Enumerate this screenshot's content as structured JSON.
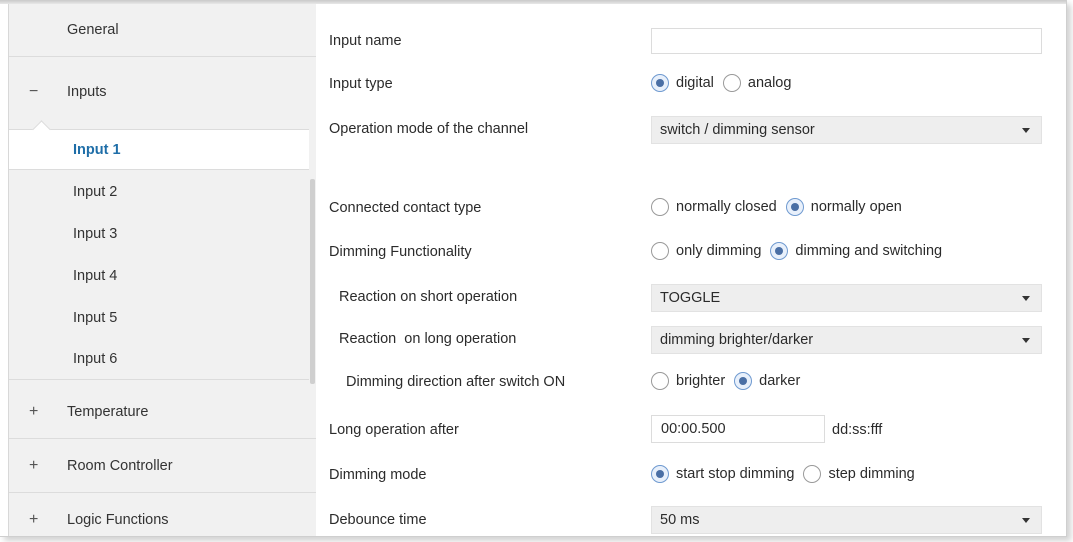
{
  "sidebar": {
    "general": "General",
    "inputs": {
      "symbol": "−",
      "label": "Inputs"
    },
    "sub_items": [
      "Input 1",
      "Input 2",
      "Input 3",
      "Input 4",
      "Input 5",
      "Input 6"
    ],
    "temperature": {
      "symbol": "+",
      "label": "Temperature"
    },
    "room_controller": {
      "symbol": "+",
      "label": "Room Controller"
    },
    "logic_functions": {
      "symbol": "+",
      "label": "Logic Functions"
    }
  },
  "form": {
    "input_name": {
      "label": "Input name",
      "value": ""
    },
    "input_type": {
      "label": "Input type",
      "options": [
        "digital",
        "analog"
      ],
      "selected": "digital"
    },
    "operation_mode": {
      "label": "Operation mode of the channel",
      "value": "switch / dimming sensor"
    },
    "contact_type": {
      "label": "Connected contact type",
      "options": [
        "normally closed",
        "normally open"
      ],
      "selected": "normally open"
    },
    "dimming_functionality": {
      "label": "Dimming Functionality",
      "options": [
        "only dimming",
        "dimming and switching"
      ],
      "selected": "dimming and switching"
    },
    "short_reaction": {
      "label": "Reaction on short operation",
      "value": "TOGGLE"
    },
    "long_reaction": {
      "label": "Reaction  on long operation",
      "value": "dimming brighter/darker"
    },
    "dimming_direction": {
      "label": "Dimming direction after switch ON",
      "options": [
        "brighter",
        "darker"
      ],
      "selected": "darker"
    },
    "long_operation_after": {
      "label": "Long operation after",
      "value": "00:00.500",
      "unit": "dd:ss:fff"
    },
    "dimming_mode": {
      "label": "Dimming mode",
      "options": [
        "start stop dimming",
        "step dimming"
      ],
      "selected": "start stop dimming"
    },
    "debounce_time": {
      "label": "Debounce time",
      "value": "50 ms"
    }
  },
  "colors": {
    "accent": "#1f6ea8",
    "sidebar_bg": "#f1f1f1",
    "select_bg": "#eeeeee",
    "radio_dot": "#4a6fa5"
  }
}
